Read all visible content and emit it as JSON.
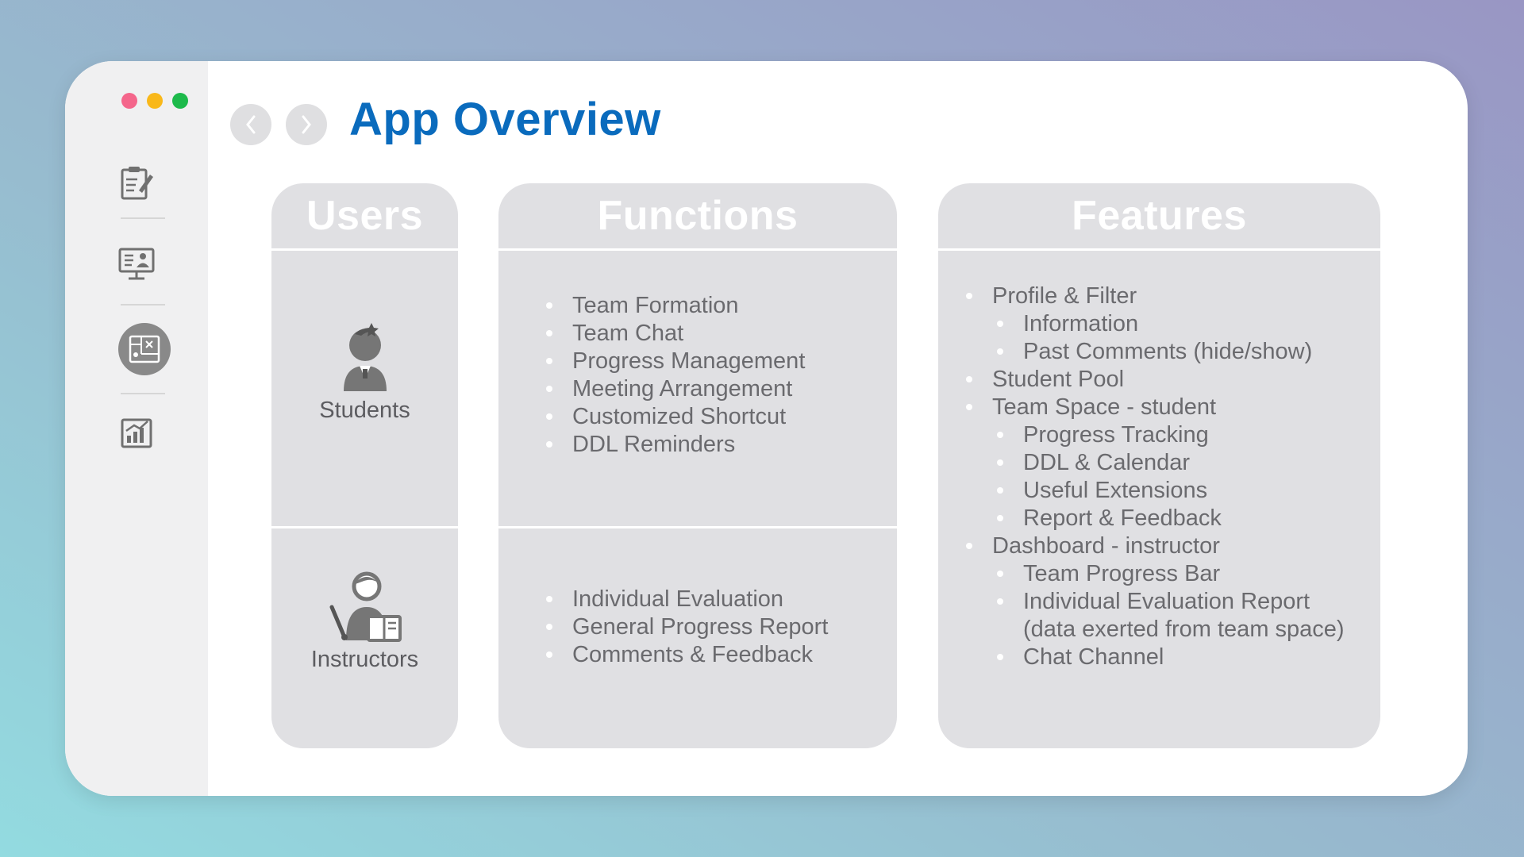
{
  "window": {
    "controls": [
      "close",
      "minimize",
      "maximize"
    ],
    "title": "App Overview"
  },
  "navigation": {
    "back_icon": "chevron-left-icon",
    "forward_icon": "chevron-right-icon"
  },
  "sidebar": {
    "items": [
      {
        "icon": "notes-edit-icon",
        "active": false
      },
      {
        "icon": "presentation-screen-icon",
        "active": false
      },
      {
        "icon": "blueprint-icon",
        "active": true
      },
      {
        "icon": "chart-report-icon",
        "active": false
      }
    ]
  },
  "columns": {
    "users": {
      "header": "Users",
      "items": [
        {
          "label": "Students",
          "icon": "student-icon"
        },
        {
          "label": "Instructors",
          "icon": "instructor-icon"
        }
      ]
    },
    "functions": {
      "header": "Functions",
      "students": [
        "Team Formation",
        "Team Chat",
        "Progress Management",
        "Meeting Arrangement",
        "Customized Shortcut",
        "DDL Reminders"
      ],
      "instructors": [
        "Individual Evaluation",
        "General Progress Report",
        "Comments & Feedback"
      ]
    },
    "features": {
      "header": "Features",
      "items": [
        {
          "text": "Profile & Filter",
          "level": 0
        },
        {
          "text": "Information",
          "level": 1
        },
        {
          "text": "Past Comments (hide/show)",
          "level": 1
        },
        {
          "text": "Student Pool",
          "level": 0
        },
        {
          "text": "Team Space - student",
          "level": 0
        },
        {
          "text": "Progress Tracking",
          "level": 1
        },
        {
          "text": "DDL & Calendar",
          "level": 1
        },
        {
          "text": "Useful Extensions",
          "level": 1
        },
        {
          "text": "Report & Feedback",
          "level": 1
        },
        {
          "text": "Dashboard - instructor",
          "level": 0
        },
        {
          "text": "Team Progress Bar",
          "level": 1
        },
        {
          "text": "Individual Evaluation Report (data exerted from team space)",
          "level": 1
        },
        {
          "text": "Chat Channel",
          "level": 1
        }
      ]
    }
  },
  "colors": {
    "title": "#0a6bbd",
    "panel": "#e0e0e3",
    "text": "#6a6a6e"
  }
}
